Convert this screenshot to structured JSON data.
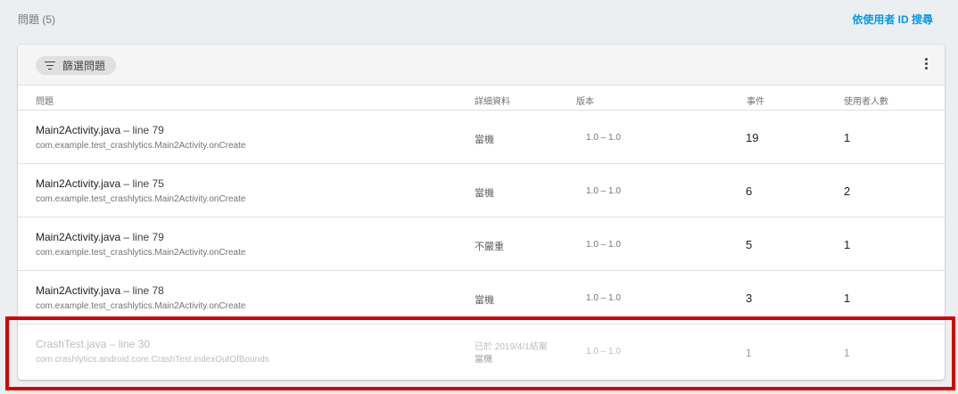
{
  "header": {
    "issues_count": "問題 (5)",
    "search_by_user": "依使用者 ID 搜尋"
  },
  "card": {
    "filter_label": "篩選問題",
    "columns": {
      "issue": "問題",
      "details": "詳細資料",
      "version": "版本",
      "events": "事件",
      "users": "使用者人數"
    },
    "rows": [
      {
        "file": "Main2Activity.java",
        "line": " – line 79",
        "method": "com.example.test_crashlytics.Main2Activity.onCreate",
        "details": "當機",
        "version": "1.0 – 1.0",
        "events": "19",
        "users": "1"
      },
      {
        "file": "Main2Activity.java",
        "line": " – line 75",
        "method": "com.example.test_crashlytics.Main2Activity.onCreate",
        "details": "當機",
        "version": "1.0 – 1.0",
        "events": "6",
        "users": "2"
      },
      {
        "file": "Main2Activity.java",
        "line": " – line 79",
        "method": "com.example.test_crashlytics.Main2Activity.onCreate",
        "details": "不嚴重",
        "version": "1.0 – 1.0",
        "events": "5",
        "users": "1"
      },
      {
        "file": "Main2Activity.java",
        "line": " – line 78",
        "method": "com.example.test_crashlytics.Main2Activity.onCreate",
        "details": "當機",
        "version": "1.0 – 1.0",
        "events": "3",
        "users": "1"
      },
      {
        "file": "CrashTest.java",
        "line": " – line 30",
        "method": "com.crashlytics.android.core.CrashTest.indexOutOfBounds",
        "status": "已於 2019/4/1結案",
        "details": "當機",
        "version": "1.0 – 1.0",
        "events": "1",
        "users": "1"
      }
    ]
  },
  "colors": {
    "accent": "#039be5",
    "highlight": "#d50000"
  },
  "icons": {
    "filter": "filter-icon",
    "more": "more-vert-icon"
  }
}
